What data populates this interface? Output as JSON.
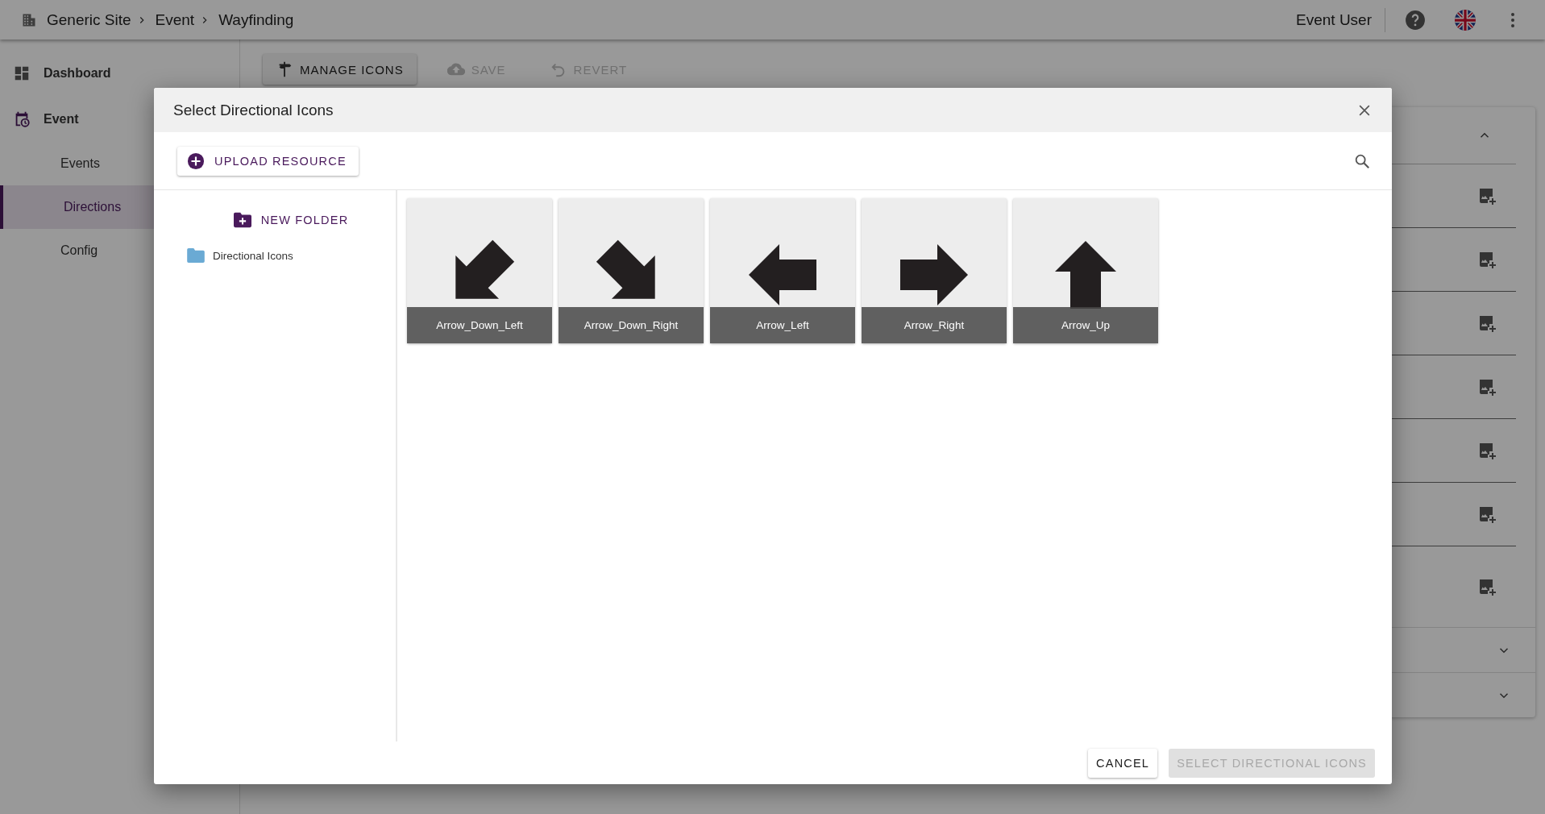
{
  "top_bar": {
    "breadcrumb": [
      "Generic Site",
      "Event",
      "Wayfinding"
    ],
    "user": "Event User"
  },
  "sidebar": {
    "items": [
      {
        "label": "Dashboard"
      },
      {
        "label": "Event",
        "children": [
          {
            "label": "Events",
            "selected": false
          },
          {
            "label": "Directions",
            "selected": true
          },
          {
            "label": "Config",
            "selected": false
          }
        ]
      }
    ]
  },
  "toolbar": {
    "buttons": [
      {
        "label": "MANAGE ICONS",
        "disabled": false
      },
      {
        "label": "SAVE",
        "disabled": true
      },
      {
        "label": "REVERT",
        "disabled": true
      }
    ]
  },
  "panel": {
    "sections": [
      {
        "expanded": true
      },
      {
        "expanded": false
      },
      {
        "expanded": false
      }
    ]
  },
  "dialog": {
    "title": "Select Directional Icons",
    "upload_button": "UPLOAD RESOURCE",
    "new_folder_button": "NEW FOLDER",
    "folders": [
      {
        "name": "Directional Icons"
      }
    ],
    "tiles": [
      {
        "label": "Arrow_Down_Left",
        "kind": "down_left"
      },
      {
        "label": "Arrow_Down_Right",
        "kind": "down_right"
      },
      {
        "label": "Arrow_Left",
        "kind": "left"
      },
      {
        "label": "Arrow_Right",
        "kind": "right"
      },
      {
        "label": "Arrow_Up",
        "kind": "up"
      }
    ],
    "buttons": [
      {
        "label": "CANCEL",
        "disabled": false
      },
      {
        "label": "SELECT DIRECTIONAL ICONS",
        "disabled": true
      }
    ]
  }
}
